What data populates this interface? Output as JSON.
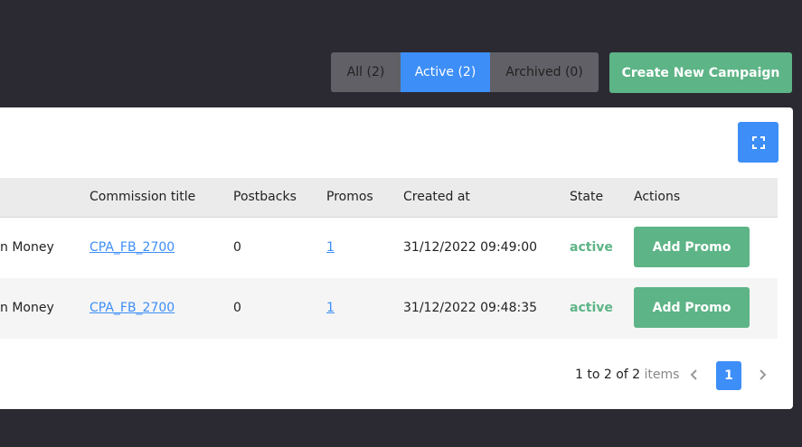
{
  "filters": {
    "all_label": "All (2)",
    "active_label": "Active (2)",
    "archived_label": "Archived (0)"
  },
  "create_button_label": "Create New Campaign",
  "colors": {
    "background": "#2b2a33",
    "accent_blue": "#3d8ef7",
    "accent_green": "#5db486",
    "filter_inactive": "#606066"
  },
  "icons": {
    "expand": "expand-icon",
    "prev": "chevron-left-icon",
    "next": "chevron-right-icon"
  },
  "table": {
    "headers": {
      "commission": "Commission title",
      "postbacks": "Postbacks",
      "promos": "Promos",
      "created": "Created at",
      "state": "State",
      "actions": "Actions"
    },
    "rows": [
      {
        "name": "n Money",
        "commission": "CPA_FB_2700",
        "postbacks": "0",
        "promos": "1",
        "created": "31/12/2022 09:49:00",
        "state": "active",
        "action_label": "Add Promo"
      },
      {
        "name": "n Money",
        "commission": "CPA_FB_2700",
        "postbacks": "0",
        "promos": "1",
        "created": "31/12/2022 09:48:35",
        "state": "active",
        "action_label": "Add Promo"
      }
    ]
  },
  "pagination": {
    "range_text": "1 to 2 of 2",
    "items_label": "items",
    "current_page": "1"
  }
}
